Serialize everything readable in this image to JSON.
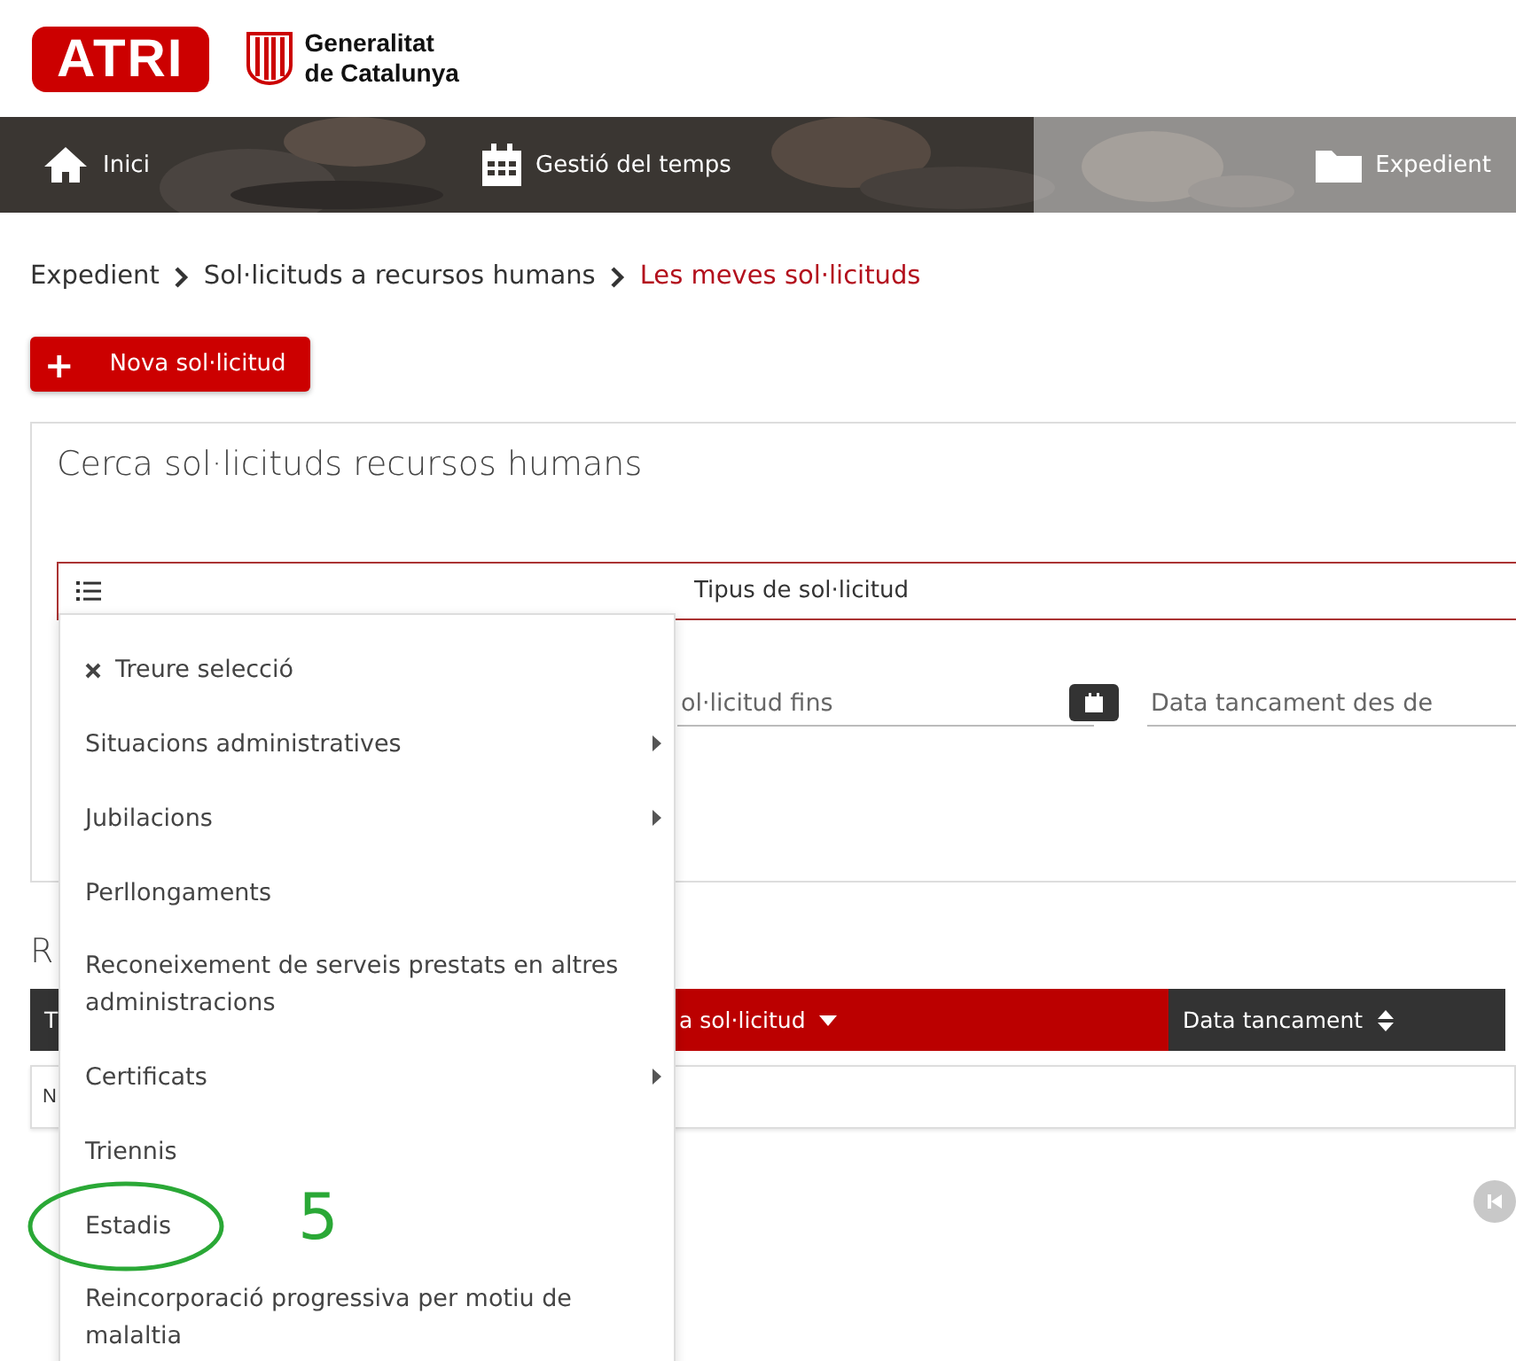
{
  "header": {
    "logo": "ATRI",
    "org_line1": "Generalitat",
    "org_line2": "de Catalunya"
  },
  "nav": [
    {
      "label": "Inici",
      "selected": false
    },
    {
      "label": "Gestió del temps",
      "selected": false
    },
    {
      "label": "Expedient",
      "selected": true
    }
  ],
  "breadcrumb": [
    {
      "label": "Expedient",
      "current": false
    },
    {
      "label": "Sol·licituds a recursos humans",
      "current": false
    },
    {
      "label": "Les meves sol·licituds",
      "current": true
    }
  ],
  "new_button": {
    "icon": "+",
    "label": "Nova sol·licitud"
  },
  "search": {
    "title": "Cerca sol·licituds recursos humans",
    "type_select": {
      "label": "Tipus de sol·licitud"
    },
    "fields": [
      {
        "placeholder": "ol·licitud fins",
        "calendar": true
      },
      {
        "placeholder": "Data tancament des de"
      }
    ]
  },
  "results": {
    "title": "R",
    "columns": [
      {
        "label": "T",
        "kind": "plain",
        "highlight": false
      },
      {
        "label": "a sol·licitud",
        "kind": "sorted_desc",
        "highlight": true
      },
      {
        "label": "Data tancament",
        "kind": "sortable",
        "highlight": false
      }
    ],
    "row_text": "N"
  },
  "dropdown": {
    "items": [
      {
        "kind": "clear",
        "label": "Treure selecció",
        "submenu": false
      },
      {
        "kind": "option",
        "label": "Situacions administratives",
        "submenu": true
      },
      {
        "kind": "option",
        "label": "Jubilacions",
        "submenu": true
      },
      {
        "kind": "option",
        "label": "Perllongaments",
        "submenu": false
      },
      {
        "kind": "option",
        "label": "Reconeixement de serveis prestats en altres administracions",
        "submenu": false
      },
      {
        "kind": "option",
        "label": "Certificats",
        "submenu": true
      },
      {
        "kind": "option",
        "label": "Triennis",
        "submenu": false
      },
      {
        "kind": "option",
        "label": "Estadis",
        "submenu": false
      },
      {
        "kind": "option",
        "label": "Reincorporació progressiva per motiu de malaltia",
        "submenu": false
      }
    ]
  },
  "annotation": {
    "label": "5",
    "color": "#2aa836"
  }
}
